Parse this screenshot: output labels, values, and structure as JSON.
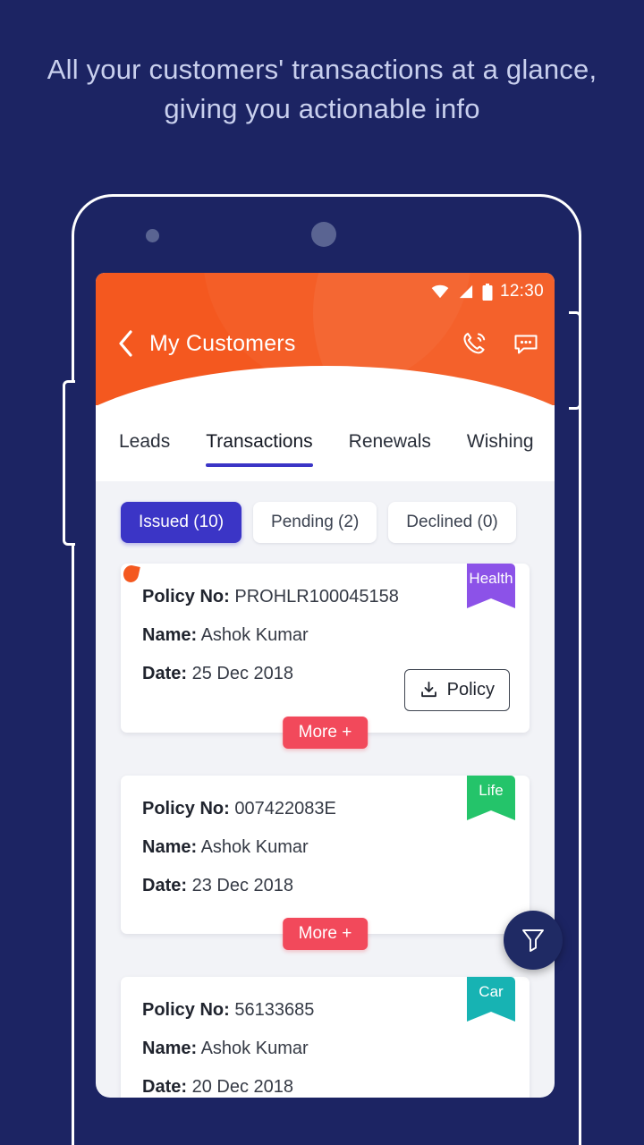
{
  "headline": {
    "line1": "All your customers' transactions at a glance,",
    "line2": "giving you actionable info"
  },
  "colors": {
    "background": "#1c2463",
    "appbar_orange": "#f4581f",
    "accent_blue": "#3b35c6",
    "more_red": "#f2495b",
    "ribbon_health": "#8c52e8",
    "ribbon_life": "#24c46a",
    "ribbon_car": "#17b3b3",
    "fab_navy": "#1f2a64"
  },
  "status_bar": {
    "time": "12:30",
    "icons": [
      "wifi-icon",
      "signal-icon",
      "battery-icon"
    ]
  },
  "appbar": {
    "back_icon": "chevron-left-icon",
    "title": "My Customers",
    "call_icon": "phone-call-icon",
    "chat_icon": "chat-message-icon"
  },
  "tabs": [
    {
      "label": "Leads",
      "active": false
    },
    {
      "label": "Transactions",
      "active": true
    },
    {
      "label": "Renewals",
      "active": false
    },
    {
      "label": "Wishing",
      "active": false
    }
  ],
  "filter_chips": [
    {
      "label": "Issued (10)",
      "active": true
    },
    {
      "label": "Pending (2)",
      "active": false
    },
    {
      "label": "Declined (0)",
      "active": false
    }
  ],
  "labels": {
    "policy_no": "Policy No:",
    "name": "Name:",
    "date": "Date:",
    "more": "More +",
    "policy_button": "Policy"
  },
  "cards": [
    {
      "policy_no": "PROHLR100045158",
      "name": "Ashok Kumar",
      "date": "25 Dec 2018",
      "ribbon": "Health",
      "ribbon_color": "#8c52e8",
      "has_policy_button": true,
      "has_more_button": true,
      "has_leaf_mark": true
    },
    {
      "policy_no": "007422083E",
      "name": "Ashok Kumar",
      "date": "23 Dec 2018",
      "ribbon": "Life",
      "ribbon_color": "#24c46a",
      "has_policy_button": false,
      "has_more_button": true,
      "has_leaf_mark": false
    },
    {
      "policy_no": "56133685",
      "name": "Ashok Kumar",
      "date": "20 Dec 2018",
      "ribbon": "Car",
      "ribbon_color": "#17b3b3",
      "has_policy_button": false,
      "has_more_button": false,
      "has_leaf_mark": false
    }
  ],
  "fab": {
    "icon": "filter-funnel-icon"
  }
}
